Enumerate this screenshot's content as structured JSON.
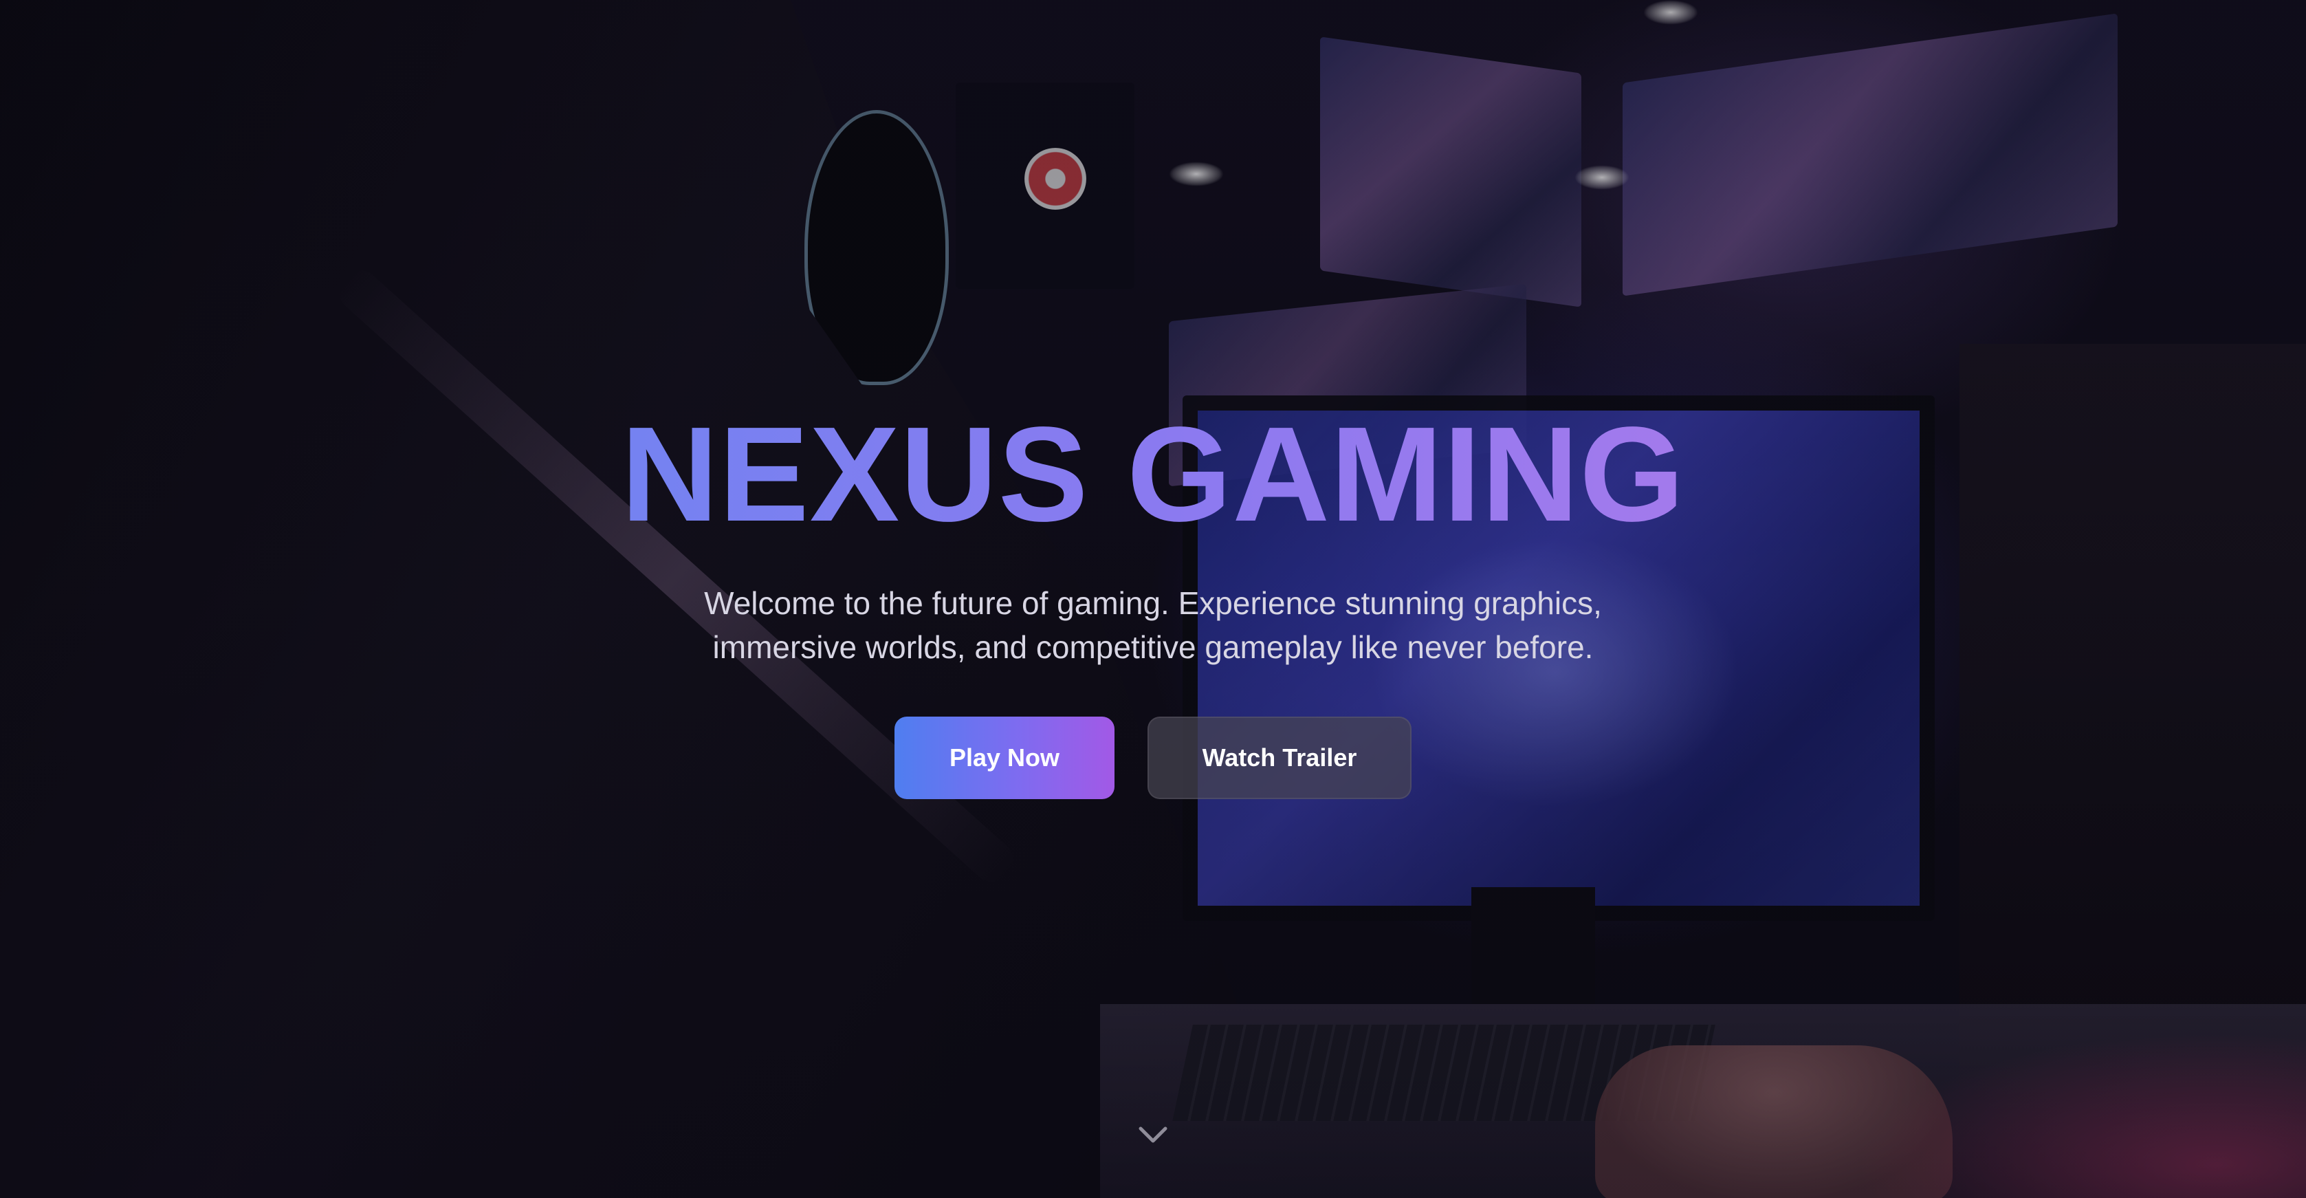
{
  "hero": {
    "title": "NEXUS GAMING",
    "subtitle": "Welcome to the future of gaming. Experience stunning graphics, immersive worlds, and competitive gameplay like never before.",
    "primary_button": "Play Now",
    "secondary_button": "Watch Trailer",
    "scroll_icon": "chevron-down-icon",
    "background_image": "gamer-at-esports-event"
  },
  "colors": {
    "gradient_start": "#5b8cf2",
    "gradient_end": "#c07ae8",
    "button_primary_start": "#4f7ef0",
    "button_primary_end": "#a259e6",
    "button_secondary": "#46444f",
    "subtitle_text": "#d8d6e4"
  }
}
